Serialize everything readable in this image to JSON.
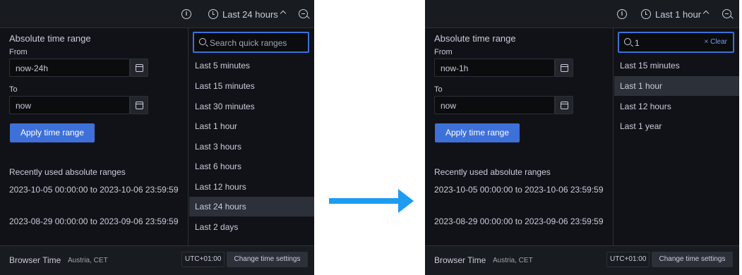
{
  "before": {
    "topbar": {
      "range_label": "Last 24 hours",
      "info_icon": "i"
    },
    "absolute": {
      "title": "Absolute time range",
      "from_label": "From",
      "from_value": "now-24h",
      "to_label": "To",
      "to_value": "now",
      "apply_label": "Apply time range"
    },
    "recent": {
      "title": "Recently used absolute ranges",
      "items": [
        "2023-10-05 00:00:00 to 2023-10-06 23:59:59",
        "2023-08-29 00:00:00 to 2023-09-06 23:59:59"
      ]
    },
    "quick": {
      "search_value": "",
      "search_placeholder": "Search quick ranges",
      "items": [
        "Last 5 minutes",
        "Last 15 minutes",
        "Last 30 minutes",
        "Last 1 hour",
        "Last 3 hours",
        "Last 6 hours",
        "Last 12 hours",
        "Last 24 hours",
        "Last 2 days"
      ],
      "selected": "Last 24 hours"
    },
    "footer": {
      "tz_name": "Browser Time",
      "tz_region": "Austria, CET",
      "tz_offset": "UTC+01:00",
      "settings_label": "Change time settings"
    }
  },
  "after": {
    "topbar": {
      "range_label": "Last 1 hour",
      "info_icon": "i"
    },
    "absolute": {
      "title": "Absolute time range",
      "from_label": "From",
      "from_value": "now-1h",
      "to_label": "To",
      "to_value": "now",
      "apply_label": "Apply time range"
    },
    "recent": {
      "title": "Recently used absolute ranges",
      "items": [
        "2023-10-05 00:00:00 to 2023-10-06 23:59:59",
        "2023-08-29 00:00:00 to 2023-09-06 23:59:59"
      ]
    },
    "quick": {
      "search_value": "1",
      "search_placeholder": "Search quick ranges",
      "clear_label": "× Clear",
      "items": [
        "Last 15 minutes",
        "Last 1 hour",
        "Last 12 hours",
        "Last 1 year"
      ],
      "selected": "Last 1 hour"
    },
    "footer": {
      "tz_name": "Browser Time",
      "tz_region": "Austria, CET",
      "tz_offset": "UTC+01:00",
      "settings_label": "Change time settings"
    }
  },
  "colors": {
    "panel_bg": "#111217",
    "bar_bg": "#181b1f",
    "accent": "#3d71d9",
    "arrow": "#1e9cf0",
    "text": "#ccccdc"
  }
}
